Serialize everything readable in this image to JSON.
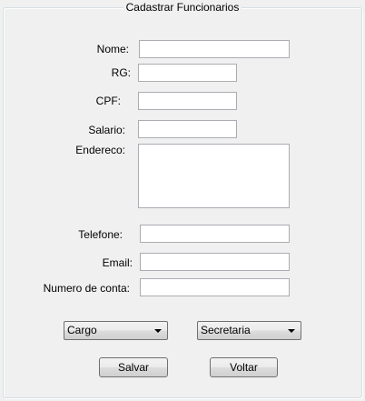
{
  "window": {
    "title": "Cadastrar Funcionarios"
  },
  "form": {
    "nome_label": "Nome:",
    "rg_label": "RG:",
    "cpf_label": "CPF:",
    "salario_label": "Salario:",
    "endereco_label": "Endereco:",
    "telefone_label": "Telefone:",
    "email_label": "Email:",
    "conta_label": "Numero de conta:",
    "nome_value": "",
    "rg_value": "",
    "cpf_value": "",
    "salario_value": "",
    "endereco_value": "",
    "telefone_value": "",
    "email_value": "",
    "conta_value": ""
  },
  "selects": {
    "cargo": "Cargo",
    "setor": "Secretaria"
  },
  "buttons": {
    "salvar": "Salvar",
    "voltar": "Voltar"
  }
}
